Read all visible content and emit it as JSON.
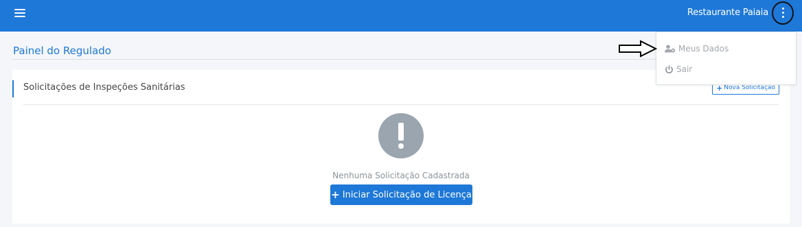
{
  "topbar": {
    "menu_icon": "hamburger-icon",
    "user_name": "Restaurante Paiaia",
    "more_icon": "kebab-vertical-icon",
    "color": "#1e78d8"
  },
  "page": {
    "title": "Painel do Regulado"
  },
  "card": {
    "title": "Solicitações de Inspeções Sanitárias",
    "new_button": {
      "icon": "plus-icon",
      "label": "Nova Solicitação"
    },
    "empty_icon": "exclamation-circle-icon",
    "empty_text": "Nenhuma Solicitação Cadastrada",
    "start_button": {
      "icon": "plus-icon",
      "label": "Iniciar Solicitação de Licença"
    }
  },
  "dropdown": {
    "items": [
      {
        "icon": "user-gear-icon",
        "label": "Meus Dados"
      },
      {
        "icon": "power-icon",
        "label": "Sair"
      }
    ]
  },
  "annotation": {
    "icon": "right-arrow-icon"
  }
}
